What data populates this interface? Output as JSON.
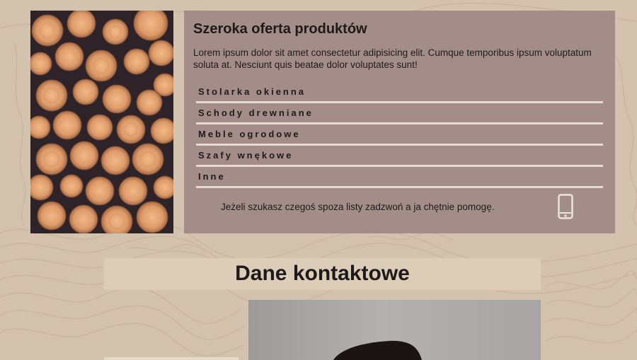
{
  "products": {
    "title": "Szeroka oferta produktów",
    "description": "Lorem ipsum dolor sit amet consectetur adipisicing elit. Cumque temporibus ipsum voluptatum soluta at. Nesciunt quis beatae dolor voluptates sunt!",
    "items": [
      "Stolarka okienna",
      "Schody drewniane",
      "Meble ogrodowe",
      "Szafy wnękowe",
      "Inne"
    ],
    "call_text": "Jeżeli szukasz czegoś spoza listy zadzwoń a ja chętnie pomogę.",
    "phone_icon": "smartphone-icon"
  },
  "contact": {
    "heading": "Dane kontaktowe"
  },
  "colors": {
    "background": "#d3c2ae",
    "panel": "#967d7d",
    "heading_box": "#dccdb9",
    "divider": "#e6dbd2"
  }
}
